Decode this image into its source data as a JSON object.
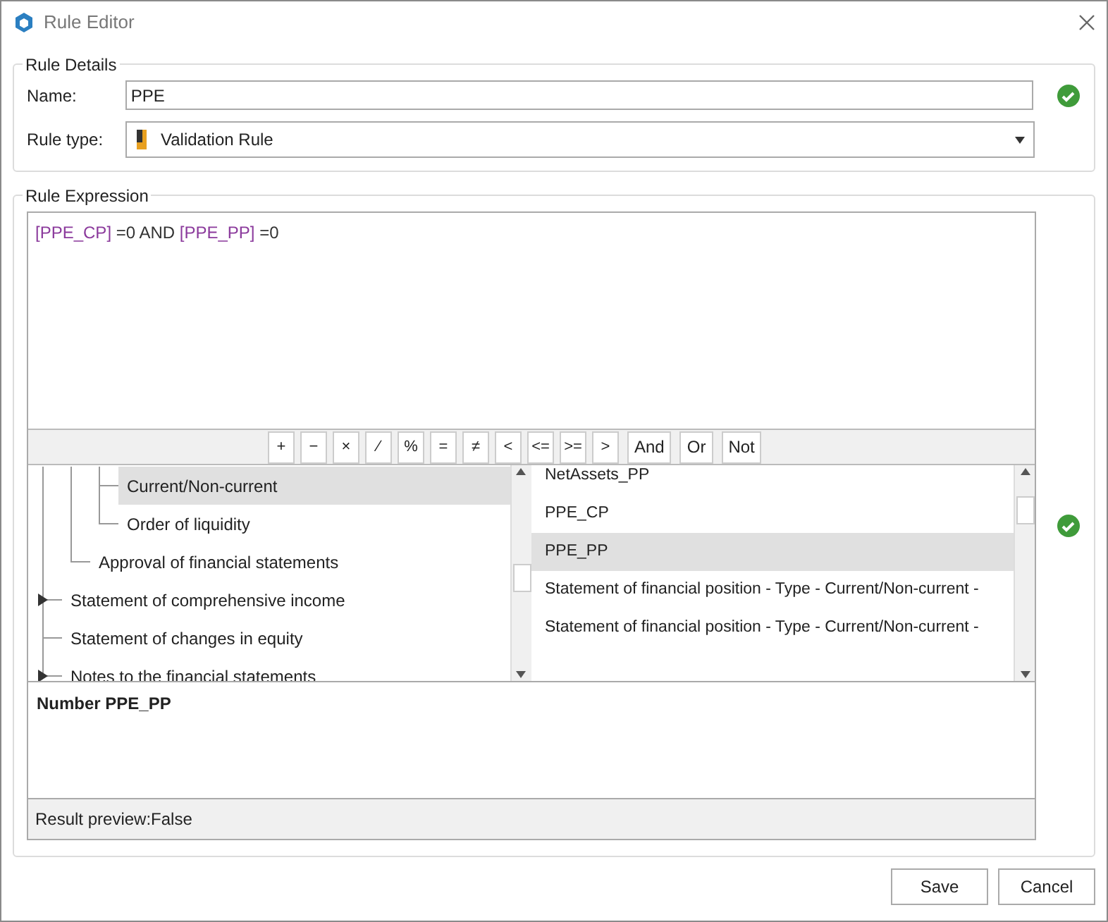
{
  "window": {
    "title": "Rule Editor"
  },
  "rule_details": {
    "legend": "Rule Details",
    "name_label": "Name:",
    "name_value": "PPE",
    "name_valid": true,
    "type_label": "Rule type:",
    "type_value": "Validation Rule"
  },
  "rule_expression": {
    "legend": "Rule Expression",
    "valid": true,
    "tokens": [
      {
        "kind": "field",
        "text": "[PPE_CP]"
      },
      {
        "kind": "text",
        "text": " =0 AND "
      },
      {
        "kind": "field",
        "text": "[PPE_PP]"
      },
      {
        "kind": "text",
        "text": " =0"
      }
    ],
    "operators": [
      {
        "label": "+",
        "kind": "symbol"
      },
      {
        "label": "−",
        "kind": "symbol"
      },
      {
        "label": "×",
        "kind": "symbol"
      },
      {
        "label": "∕",
        "kind": "symbol"
      },
      {
        "label": "%",
        "kind": "symbol"
      },
      {
        "label": "=",
        "kind": "symbol"
      },
      {
        "label": "≠",
        "kind": "symbol"
      },
      {
        "label": "<",
        "kind": "symbol"
      },
      {
        "label": "<=",
        "kind": "symbol"
      },
      {
        "label": ">=",
        "kind": "symbol"
      },
      {
        "label": ">",
        "kind": "symbol"
      },
      {
        "label": "And",
        "kind": "word"
      },
      {
        "label": "Or",
        "kind": "word"
      },
      {
        "label": "Not",
        "kind": "word"
      }
    ],
    "tree": [
      {
        "children": [
          {
            "children": [
              {
                "label": "Current/Non-current",
                "collapsed": false,
                "selected": true
              },
              {
                "label": "Order of liquidity",
                "collapsed": false,
                "selected": false
              }
            ]
          },
          {
            "label": "Approval of financial statements",
            "collapsed": false,
            "selected": false
          }
        ]
      },
      {
        "label": "Statement of comprehensive income",
        "collapsed": true,
        "selected": false
      },
      {
        "label": "Statement of changes in equity",
        "collapsed": false,
        "selected": false
      },
      {
        "label": "Notes to the financial statements",
        "collapsed": true,
        "selected": false
      }
    ],
    "fields": [
      {
        "label": "NetAssets_PP",
        "selected": false
      },
      {
        "label": "PPE_CP",
        "selected": false
      },
      {
        "label": "PPE_PP",
        "selected": true
      },
      {
        "label": "Statement of financial position - Type - Current/Non-current -",
        "selected": false
      },
      {
        "label": "Statement of financial position - Type - Current/Non-current -",
        "selected": false
      }
    ],
    "description": "Number PPE_PP",
    "result_preview": "Result preview:False"
  },
  "buttons": [
    {
      "label": "Save"
    },
    {
      "label": "Cancel"
    }
  ]
}
